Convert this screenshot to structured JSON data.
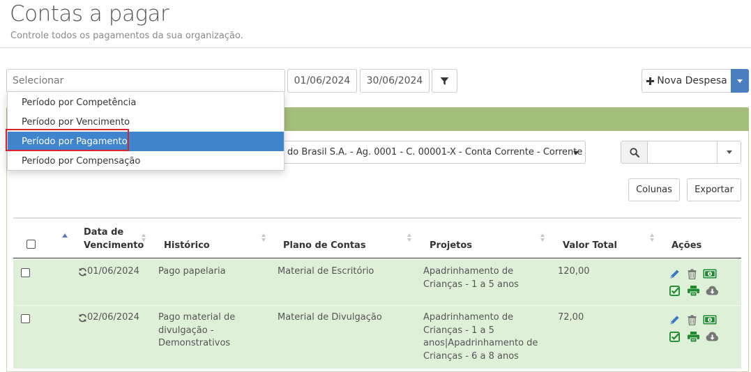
{
  "header": {
    "title": "Contas a pagar",
    "subtitle": "Controle todos os pagamentos da sua organização."
  },
  "filters": {
    "period_select_placeholder": "Selecionar",
    "date_start": "01/06/2024",
    "date_end": "30/06/2024",
    "period_options": [
      "Período por Competência",
      "Período por Vencimento",
      "Período por Pagamento",
      "Período por Compensação"
    ],
    "selected_option": "Período por Pagamento"
  },
  "toolbar": {
    "new_expense_label": "Nova Despesa",
    "account_select_text": "do Brasil S.A. - Ag. 0001 - C. 00001-X - Conta Corrente - Corrente",
    "search_value": "",
    "columns_label": "Colunas",
    "export_label": "Exportar"
  },
  "table": {
    "headers": {
      "due_date": [
        "Data de",
        "Vencimento"
      ],
      "history": "Histórico",
      "chart_of_accounts": "Plano de Contas",
      "projects": "Projetos",
      "total_value": "Valor Total",
      "actions": "Ações"
    },
    "rows": [
      {
        "due_date": "01/06/2024",
        "history": [
          "Pago papelaria"
        ],
        "chart_of_accounts": "Material de Escritório",
        "projects": [
          "Apadrinhamento de",
          "Crianças - 1 a 5 anos"
        ],
        "total_value": "120,00"
      },
      {
        "due_date": "02/06/2024",
        "history": [
          "Pago material de",
          "divulgação -",
          "Demonstrativos"
        ],
        "chart_of_accounts": "Material de Divulgação",
        "projects": [
          "Apadrinhamento de",
          "Crianças - 1 a 5",
          "anos|Apadrinhamento de",
          "Crianças - 6 a 8 anos"
        ],
        "total_value": "72,00"
      }
    ]
  },
  "colors": {
    "panel_header": "#a4be7b",
    "row_background": "#dff0d8",
    "selected_option": "#3f85cd",
    "highlight_border": "#d9232d",
    "action_blue": "#3a79c2",
    "action_green": "#1e8a2e",
    "action_gray": "#777777"
  },
  "icons": {
    "filter": "filter-icon",
    "plus": "plus-icon",
    "search": "search-icon",
    "recurring": "recurring-icon",
    "edit": "pencil-icon",
    "delete": "trash-icon",
    "pay": "money-icon",
    "confirm": "check-square-icon",
    "print": "print-icon",
    "download": "cloud-download-icon"
  }
}
